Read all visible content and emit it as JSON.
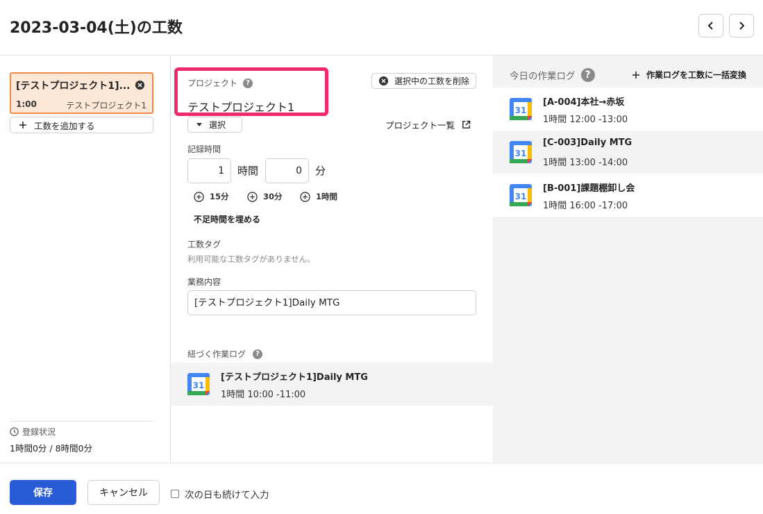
{
  "header": {
    "title": "2023-03-04(土)の工数"
  },
  "left": {
    "entry": {
      "title": "[テストプロジェクト1]...",
      "time": "1:00",
      "project": "テストプロジェクト1"
    },
    "add_label": "工数を追加する",
    "status": {
      "label": "登録状況",
      "value": "1時間0分 / 8時間0分"
    }
  },
  "form": {
    "project_label": "プロジェクト",
    "project_value": "テストプロジェクト1",
    "delete_label": "選択中の工数を削除",
    "select_label": "選択",
    "project_list_label": "プロジェクト一覧",
    "record_label": "記録時間",
    "hours": "1",
    "hours_unit": "時間",
    "minutes": "0",
    "minutes_unit": "分",
    "quick": [
      "15分",
      "30分",
      "1時間"
    ],
    "fill_label": "不足時間を埋める",
    "tag_label": "工数タグ",
    "tag_empty": "利用可能な工数タグがありません。",
    "work_label": "業務内容",
    "work_value": "[テストプロジェクト1]Daily MTG",
    "linked_label": "紐づく作業ログ",
    "linked_log": {
      "title": "[テストプロジェクト1]Daily MTG",
      "time": "1時間  10:00 -11:00"
    }
  },
  "today": {
    "label": "今日の作業ログ",
    "convert_label": "作業ログを工数に一括変換",
    "logs": [
      {
        "title": "[A-004]本社→赤坂",
        "time": "1時間  12:00 -13:00"
      },
      {
        "title": "[C-003]Daily MTG",
        "time": "1時間  13:00 -14:00"
      },
      {
        "title": "[B-001]課題棚卸し会",
        "time": "1時間  16:00 -17:00"
      }
    ],
    "calendar_day": "31"
  },
  "footer": {
    "save_label": "保存",
    "cancel_label": "キャンセル",
    "next_day_label": "次の日も続けて入力"
  },
  "colors": {
    "accent": "#2a5bd7",
    "highlight": "#ee2a6c",
    "entry_border": "#f08a45",
    "entry_bg": "#fde7d7"
  }
}
